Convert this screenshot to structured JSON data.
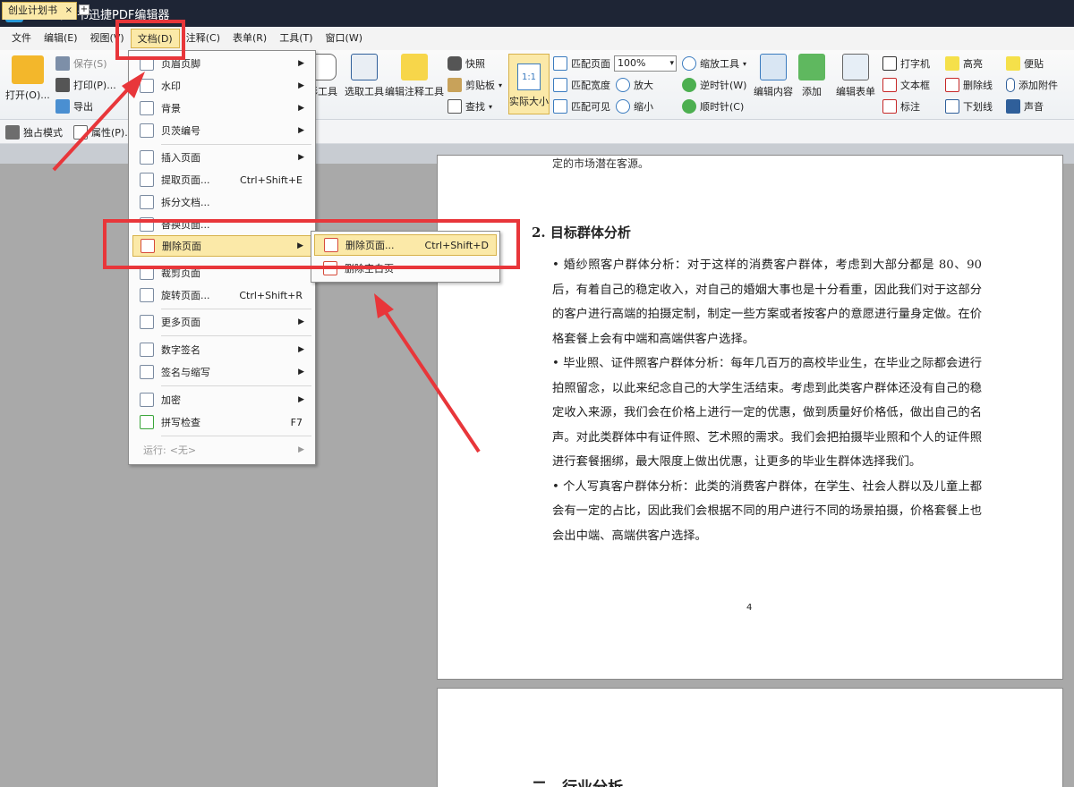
{
  "window": {
    "title": "创业计划书迅捷PDF编辑器",
    "logo_letter": "P"
  },
  "menubar": [
    {
      "label": "文件"
    },
    {
      "label": "编辑(E)"
    },
    {
      "label": "视图(V)"
    },
    {
      "label": "文档(D)"
    },
    {
      "label": "注释(C)"
    },
    {
      "label": "表单(R)"
    },
    {
      "label": "工具(T)"
    },
    {
      "label": "窗口(W)"
    }
  ],
  "ribbon": {
    "open": "打开(O)...",
    "save": "保存(S)",
    "print": "打印(P)...",
    "export": "导出",
    "exclusive_mode": "独占模式",
    "properties": "属性(P)...",
    "hand_tool": "形工具",
    "select_tool": "选取工具",
    "edit_annotation_tool": "编辑注释工具",
    "snapshot": "快照",
    "clipboard": "剪贴板",
    "find": "查找",
    "actual_size": "实际大小",
    "actual_size_icon": "1:1",
    "fit_page": "匹配页面",
    "fit_width": "匹配宽度",
    "fit_visible": "匹配可见",
    "zoom_value": "100%",
    "zoom_tool": "缩放工具",
    "zoom_in": "放大",
    "zoom_out": "缩小",
    "rotate_ccw": "逆时针(W)",
    "rotate_cw": "顺时针(C)",
    "edit_content": "编辑内容",
    "add": "添加",
    "edit_form": "编辑表单",
    "typewriter": "打字机",
    "text_box": "文本框",
    "callout": "标注",
    "highlight": "高亮",
    "strikethrough": "删除线",
    "underline": "下划线",
    "sticky_note": "便贴",
    "attach_file": "添加附件",
    "sound": "声音"
  },
  "tab": {
    "label": "创业计划书",
    "close": "×",
    "add": "+"
  },
  "document_menu": {
    "items": [
      {
        "label": "页眉页脚",
        "submenu": true
      },
      {
        "label": "水印",
        "submenu": true
      },
      {
        "label": "背景",
        "submenu": true
      },
      {
        "label": "贝茨编号",
        "submenu": true
      },
      {
        "label": "插入页面",
        "submenu": true
      },
      {
        "label": "提取页面...",
        "shortcut": "Ctrl+Shift+E"
      },
      {
        "label": "拆分文档..."
      },
      {
        "label": "替换页面..."
      },
      {
        "label": "删除页面",
        "submenu": true
      },
      {
        "label": "裁剪页面"
      },
      {
        "label": "旋转页面...",
        "shortcut": "Ctrl+Shift+R"
      },
      {
        "label": "更多页面",
        "submenu": true
      },
      {
        "label": "数字签名",
        "submenu": true
      },
      {
        "label": "签名与缩写",
        "submenu": true
      },
      {
        "label": "加密",
        "submenu": true
      },
      {
        "label": "拼写检查",
        "shortcut": "F7"
      },
      {
        "label": "运行: ",
        "value": "<无>",
        "submenu": true
      }
    ]
  },
  "delete_submenu": {
    "items": [
      {
        "label": "删除页面...",
        "shortcut": "Ctrl+Shift+D"
      },
      {
        "label": "删除空白页"
      }
    ]
  },
  "page": {
    "top_fragment": "定的市场潜在客源。",
    "heading": "2. 目标群体分析",
    "paragraphs": [
      "• 婚纱照客户群体分析：对于这样的消费客户群体，考虑到大部分都是 80、90 后，有着自己的稳定收入，对自己的婚姻大事也是十分看重，因此我们对于这部分的客户进行高端的拍摄定制，制定一些方案或者按客户的意愿进行量身定做。在价格套餐上会有中端和高端供客户选择。",
      "• 毕业照、证件照客户群体分析：每年几百万的高校毕业生，在毕业之际都会进行拍照留念，以此来纪念自己的大学生活结束。考虑到此类客户群体还没有自己的稳定收入来源，我们会在价格上进行一定的优惠，做到质量好价格低，做出自己的名声。对此类群体中有证件照、艺术照的需求。我们会把拍摄毕业照和个人的证件照进行套餐捆绑，最大限度上做出优惠，让更多的毕业生群体选择我们。",
      "• 个人写真客户群体分析：此类的消费客户群体，在学生、社会人群以及儿童上都会有一定的占比，因此我们会根据不同的用户进行不同的场景拍摄，价格套餐上也会出中端、高端供客户选择。"
    ],
    "page_number": "4",
    "next_heading": "二、行业分析"
  },
  "colors": {
    "highlight": "#e8363a",
    "menu_hover": "#fbe9a8",
    "titlebar": "#1e2535"
  }
}
